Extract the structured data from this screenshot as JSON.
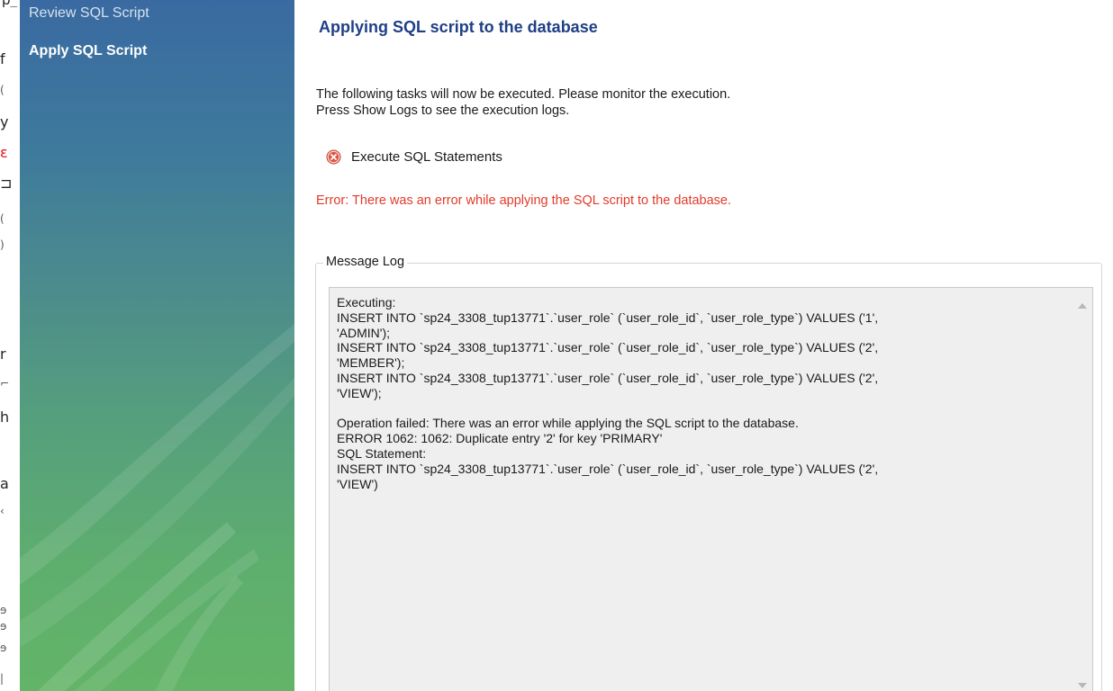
{
  "background": {
    "fragments": [
      "f",
      "y",
      "r",
      "h",
      "a"
    ]
  },
  "sidebar": {
    "items": [
      {
        "label": "Review SQL Script",
        "active": false
      },
      {
        "label": "Apply SQL Script",
        "active": true
      }
    ]
  },
  "main": {
    "title": "Applying SQL script to the database",
    "intro_lines": [
      "The following tasks will now be executed. Please monitor the execution.",
      "Press Show Logs to see the execution logs."
    ],
    "task": {
      "label": "Execute SQL Statements",
      "status": "error",
      "icon": "error-circle-x-icon"
    },
    "error_message": "Error: There was an error while applying the SQL script to the database.",
    "message_log": {
      "legend": "Message Log",
      "content": "Executing:\nINSERT INTO `sp24_3308_tup13771`.`user_role` (`user_role_id`, `user_role_type`) VALUES ('1',\n'ADMIN');\nINSERT INTO `sp24_3308_tup13771`.`user_role` (`user_role_id`, `user_role_type`) VALUES ('2',\n'MEMBER');\nINSERT INTO `sp24_3308_tup13771`.`user_role` (`user_role_id`, `user_role_type`) VALUES ('2',\n'VIEW');\n\nOperation failed: There was an error while applying the SQL script to the database.\nERROR 1062: 1062: Duplicate entry '2' for key 'PRIMARY'\nSQL Statement:\nINSERT INTO `sp24_3308_tup13771`.`user_role` (`user_role_id`, `user_role_type`) VALUES ('2',\n'VIEW')"
    }
  },
  "colors": {
    "title": "#1f3f86",
    "error": "#e23a2a",
    "log_background": "#efefef",
    "sidebar_top": "#3a6aa1",
    "sidebar_bottom": "#63b468"
  }
}
